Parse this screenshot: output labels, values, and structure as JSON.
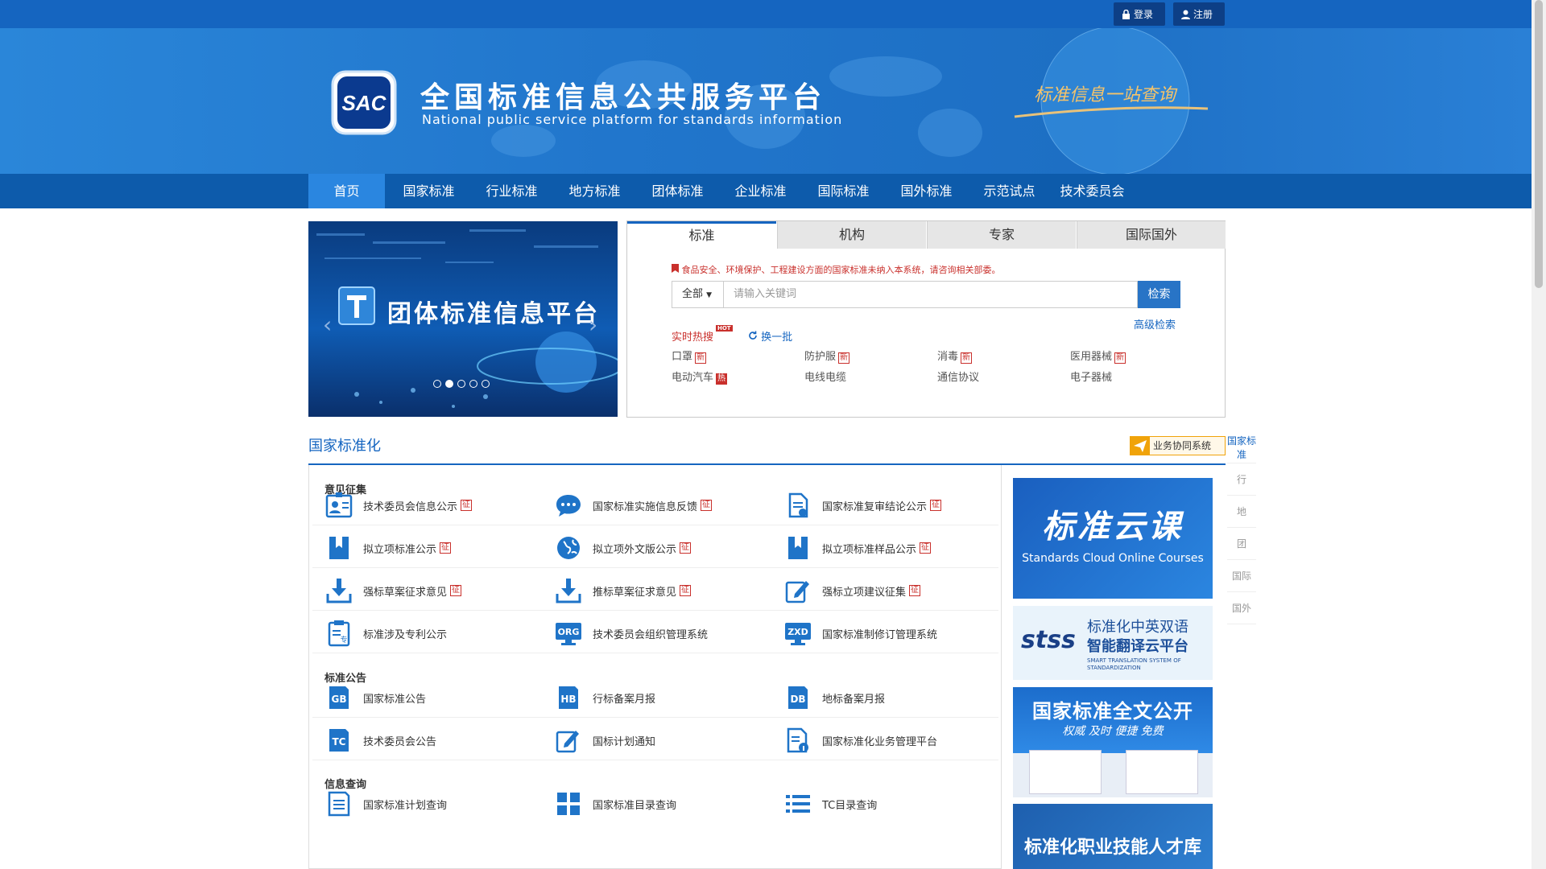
{
  "header": {
    "login": "登录",
    "register": "注册",
    "title_cn": "全国标准信息公共服务平台",
    "title_en": "National public service platform  for standards information",
    "slogan": "标准信息一站查询",
    "logo_text": "SAC"
  },
  "nav": [
    "首页",
    "国家标准",
    "行业标准",
    "地方标准",
    "团体标准",
    "企业标准",
    "国际标准",
    "国外标准",
    "示范试点",
    "技术委员会"
  ],
  "slider": {
    "title": "团体标准信息平台"
  },
  "search": {
    "tabs": [
      "标准",
      "机构",
      "专家",
      "国际国外"
    ],
    "notice": "食品安全、环境保护、工程建设方面的国家标准未纳入本系统，请咨询相关部委。",
    "scope": "全部",
    "placeholder": "请输入关键词",
    "button": "检索",
    "advanced": "高级检索",
    "hot_title": "实时热搜",
    "hot_badge": "HOT",
    "refresh": "换一批",
    "hot_items": [
      {
        "text": "口罩",
        "tag": "新"
      },
      {
        "text": "防护服",
        "tag": "新"
      },
      {
        "text": "消毒",
        "tag": "新"
      },
      {
        "text": "医用器械",
        "tag": "新"
      },
      {
        "text": "电动汽车",
        "tag": "热"
      },
      {
        "text": "电线电缆",
        "tag": ""
      },
      {
        "text": "通信协议",
        "tag": ""
      },
      {
        "text": "电子器械",
        "tag": ""
      }
    ]
  },
  "section": {
    "title": "国家标准化",
    "system_button": "业务协同系统",
    "side_nav": [
      "国家标准",
      "行",
      "地",
      "团",
      "国际",
      "国外"
    ],
    "categories": [
      "意见征集",
      "标准公告",
      "信息查询"
    ],
    "group1": [
      [
        "技术委员会信息公示",
        "国家标准实施信息反馈",
        "国家标准复审结论公示"
      ],
      [
        "拟立项标准公示",
        "拟立项外文版公示",
        "拟立项标准样品公示"
      ],
      [
        "强标草案征求意见",
        "推标草案征求意见",
        "强标立项建议征集"
      ],
      [
        "标准涉及专利公示",
        "技术委员会组织管理系统",
        "国家标准制修订管理系统"
      ]
    ],
    "zheng": "征",
    "group2": [
      [
        "国家标准公告",
        "行标备案月报",
        "地标备案月报"
      ],
      [
        "技术委员会公告",
        "国标计划通知",
        "国家标准化业务管理平台"
      ]
    ],
    "group3": [
      [
        "国家标准计划查询",
        "国家标准目录查询",
        "TC目录查询"
      ]
    ],
    "icon_labels": {
      "gb": "GB",
      "hb": "HB",
      "db": "DB",
      "tc": "TC",
      "org": "ORG",
      "zxd": "ZXD",
      "jin": "专"
    }
  },
  "promos": {
    "p1_title": "标准云课",
    "p1_sub": "Standards Cloud Online Courses",
    "p2_logo": "stss",
    "p2_title1": "标准化中英双语",
    "p2_title2": "智能翻译云平台",
    "p2_sub": "SMART TRANSLATION SYSTEM OF STANDARDIZATION",
    "p3_title": "国家标准全文公开",
    "p3_sub": "权威  及时  便捷  免费",
    "p4_title": "标准化职业技能人才库"
  }
}
